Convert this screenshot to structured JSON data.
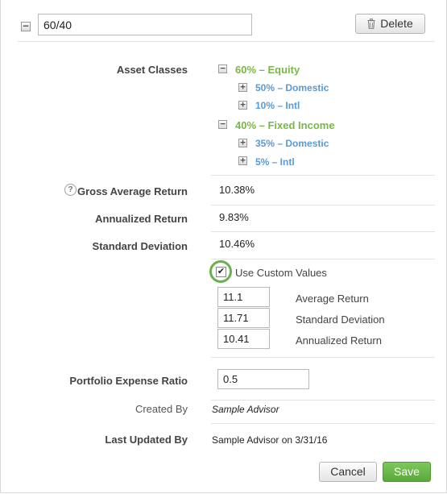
{
  "header": {
    "collapse_glyph": "−",
    "name_value": "60/40",
    "delete_label": "Delete",
    "delete_icon": "trash-icon"
  },
  "asset_classes": {
    "label": "Asset Classes",
    "groups": [
      {
        "label": "60% – Equity",
        "glyph": "−",
        "children": [
          {
            "label": "50% – Domestic",
            "glyph": "+"
          },
          {
            "label": "10% – Intl",
            "glyph": "+"
          }
        ]
      },
      {
        "label": "40% – Fixed Income",
        "glyph": "−",
        "children": [
          {
            "label": "35% – Domestic",
            "glyph": "+"
          },
          {
            "label": "5% – Intl",
            "glyph": "+"
          }
        ]
      }
    ]
  },
  "stats": {
    "help_glyph": "?",
    "gross_label": "Gross Average Return",
    "gross_value": "10.38%",
    "annualized_label": "Annualized Return",
    "annualized_value": "9.83%",
    "stddev_label": "Standard Deviation",
    "stddev_value": "10.46%"
  },
  "custom": {
    "checkbox_label": "Use Custom Values",
    "checked": true,
    "check_glyph": "✔",
    "fields": [
      {
        "label": "Average Return",
        "value": "11.1"
      },
      {
        "label": "Standard Deviation",
        "value": "11.71"
      },
      {
        "label": "Annualized Return",
        "value": "10.41"
      }
    ]
  },
  "expense": {
    "label": "Portfolio Expense Ratio",
    "value": "0.5"
  },
  "meta": {
    "created_label": "Created By",
    "created_value": "Sample Advisor",
    "updated_label": "Last Updated By",
    "updated_value": "Sample Advisor on 3/31/16"
  },
  "footer": {
    "cancel_label": "Cancel",
    "save_label": "Save"
  },
  "colors": {
    "equity_green": "#7ab648",
    "link_blue": "#5a9ad6",
    "save_green": "#5aa83a",
    "checkbox_ring": "#6ab04c"
  }
}
